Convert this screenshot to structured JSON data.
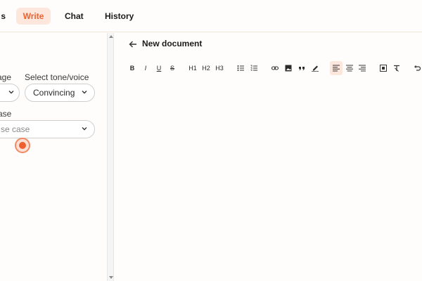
{
  "nav": {
    "tabs": [
      {
        "label": "s"
      },
      {
        "label": "Write",
        "active": true
      },
      {
        "label": "Chat"
      },
      {
        "label": "History"
      }
    ]
  },
  "sidebar": {
    "language_label": "age",
    "tone_label": "Select tone/voice",
    "tone_value": "Convincing",
    "use_case_label": "ase",
    "use_case_placeholder": "se case"
  },
  "editor": {
    "title": "New document",
    "toolbar": {
      "bold": "B",
      "italic": "I",
      "underline": "U",
      "strike": "S",
      "h1": "H1",
      "h2": "H2",
      "h3": "H3"
    }
  },
  "colors": {
    "accent": "#f0602e",
    "accent_soft": "#fde7dd",
    "background": "#fffdfb"
  }
}
